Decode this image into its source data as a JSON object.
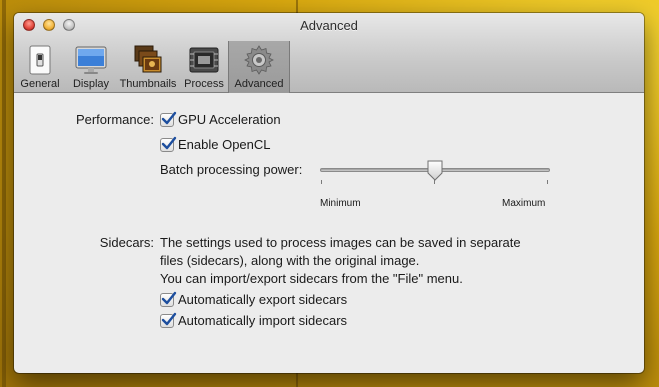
{
  "window": {
    "title": "Advanced"
  },
  "toolbar": {
    "items": [
      {
        "label": "General",
        "icon": "switch-icon"
      },
      {
        "label": "Display",
        "icon": "monitor-icon"
      },
      {
        "label": "Thumbnails",
        "icon": "thumbnails-icon"
      },
      {
        "label": "Process",
        "icon": "process-chip-icon"
      },
      {
        "label": "Advanced",
        "icon": "gear-icon",
        "selected": true
      }
    ]
  },
  "performance": {
    "label": "Performance:",
    "gpu_acceleration": {
      "label": "GPU Acceleration",
      "checked": true
    },
    "enable_opencl": {
      "label": "Enable OpenCL",
      "checked": true
    },
    "batch_power": {
      "label": "Batch processing power:",
      "min_label": "Minimum",
      "max_label": "Maximum",
      "value_fraction": 0.5
    }
  },
  "sidecars": {
    "label": "Sidecars:",
    "description_line1": "The settings used to process images can be saved in separate",
    "description_line2": "files (sidecars), along with the original image.",
    "description_line3": "You can import/export sidecars from the \"File\" menu.",
    "auto_export": {
      "label": "Automatically export sidecars",
      "checked": true
    },
    "auto_import": {
      "label": "Automatically import sidecars",
      "checked": true
    }
  },
  "colors": {
    "checkmark": "#1d4e9e",
    "background": "#d9a80f"
  }
}
